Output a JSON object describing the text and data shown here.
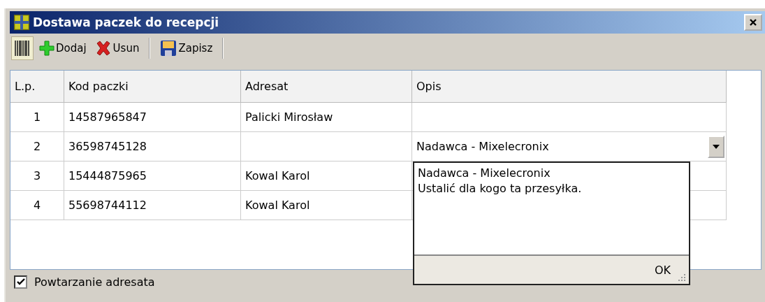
{
  "window": {
    "title": "Dostawa paczek do recepcji"
  },
  "toolbar": [
    {
      "kind": "barcode"
    },
    {
      "kind": "add",
      "label": "Dodaj"
    },
    {
      "kind": "delete",
      "label": "Usun"
    },
    {
      "kind": "save",
      "label": "Zapisz"
    }
  ],
  "table": {
    "columns": [
      "L.p.",
      "Kod paczki",
      "Adresat",
      "Opis"
    ],
    "rows": [
      {
        "cells": [
          "1",
          "14587965847",
          "Palicki Mirosław",
          ""
        ],
        "editing": false
      },
      {
        "cells": [
          "2",
          "36598745128",
          "",
          "Nadawca - Mixelecronix"
        ],
        "editing": true
      },
      {
        "cells": [
          "3",
          "15444875965",
          "Kowal Karol",
          ""
        ],
        "editing": false
      },
      {
        "cells": [
          "4",
          "55698744112",
          "Kowal Karol",
          ""
        ],
        "editing": false
      }
    ]
  },
  "memo_popup": {
    "lines": [
      "Nadawca - Mixelecronix",
      "Ustalić dla kogo ta przesyłka."
    ],
    "button": "OK"
  },
  "repeat_addressee": {
    "label": "Powtarzanie adresata",
    "checked": true
  }
}
